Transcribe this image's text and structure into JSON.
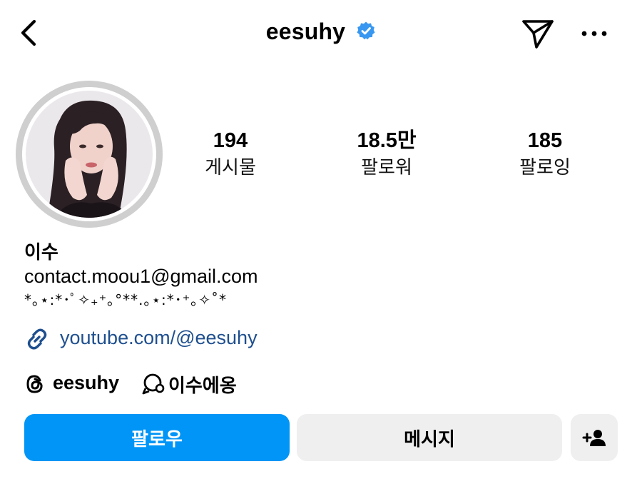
{
  "header": {
    "username": "eesuhy",
    "verified_color": "#3897f0"
  },
  "icons": {
    "back": "chevron-left-icon",
    "verified": "verified-badge-icon",
    "send": "paper-plane-icon",
    "more": "more-horizontal-icon",
    "link": "link-icon",
    "threads": "threads-icon",
    "channel": "broadcast-channel-icon",
    "suggest": "add-person-icon"
  },
  "stats": {
    "posts": {
      "value": "194",
      "label": "게시물"
    },
    "followers": {
      "value": "18.5만",
      "label": "팔로워"
    },
    "following": {
      "value": "185",
      "label": "팔로잉"
    }
  },
  "bio": {
    "name": "이수",
    "email": "contact.moou1@gmail.com",
    "decoration": "*｡⋆:*･ﾟ✧₊⁺｡°**.｡⋆:*･⁺｡✧˚*",
    "link": "youtube.com/@eesuhy",
    "threads_name": "eesuhy",
    "channel_name": "이수에옹"
  },
  "actions": {
    "follow_label": "팔로우",
    "message_label": "메시지"
  },
  "colors": {
    "follow_button": "#0095f6",
    "secondary_button": "#efefef",
    "link_text": "#1e4f8f"
  }
}
